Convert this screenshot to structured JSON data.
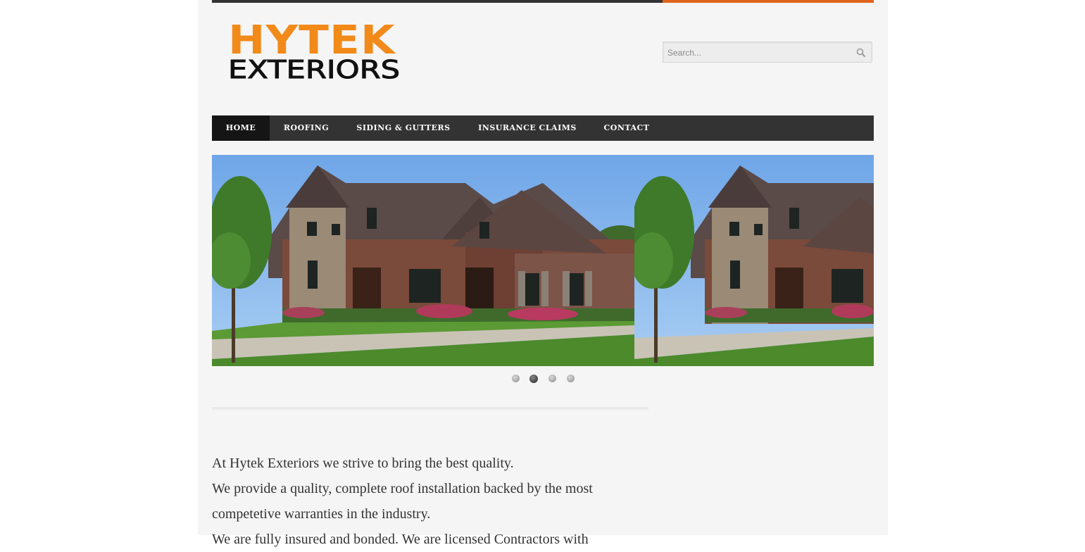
{
  "header": {
    "logo_line1": "HYTEK",
    "logo_line2": "EXTERIORS",
    "search_placeholder": "Search...",
    "search_icon": "magnifier-icon"
  },
  "nav": {
    "items": [
      {
        "label": "HOME",
        "active": true
      },
      {
        "label": "ROOFING"
      },
      {
        "label": "SIDING & GUTTERS"
      },
      {
        "label": "INSURANCE CLAIMS"
      },
      {
        "label": "CONTACT"
      }
    ]
  },
  "slider": {
    "image": "house-photo",
    "slide_count": 4,
    "active_index": 2
  },
  "content": {
    "lines": [
      "At Hytek Exteriors we strive to bring the best quality.",
      "We provide a quality, complete roof installation backed by the most",
      "competetive warranties in the industry.",
      "We are fully insured and bonded. We are licensed Contractors with"
    ]
  },
  "colors": {
    "accent": "#e0651b",
    "logo_orange": "#f28a1a",
    "nav_bg": "#333333",
    "nav_active": "#151515",
    "page_bg": "#f5f5f5"
  }
}
